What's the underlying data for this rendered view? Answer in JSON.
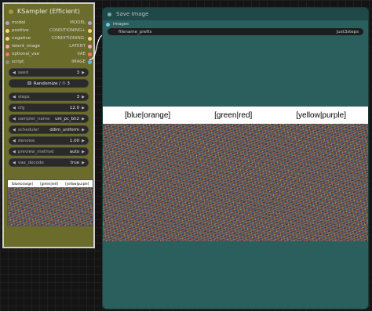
{
  "ksampler": {
    "title": "KSampler (Efficient)",
    "inputs": [
      {
        "label": "model",
        "out": "MODEL",
        "in_color": "#b39ddb",
        "out_color": "#b39ddb"
      },
      {
        "label": "positive",
        "out": "CONDITIONING+",
        "in_color": "#ffd27a",
        "out_color": "#ffd27a"
      },
      {
        "label": "negative",
        "out": "CONDITIONING-",
        "in_color": "#ffd27a",
        "out_color": "#ffd27a"
      },
      {
        "label": "latent_image",
        "out": "LATENT",
        "in_color": "#ff9cb4",
        "out_color": "#ff9cb4"
      },
      {
        "label": "optional_vae",
        "out": "VAE",
        "in_color": "#ff6e6e",
        "out_color": "#ff6e6e"
      },
      {
        "label": "script",
        "out": "IMAGE",
        "in_color": "#8a8a8a",
        "out_color": "#64b5f6"
      }
    ],
    "widgets": {
      "seed": {
        "label": "seed",
        "value": "3"
      },
      "randomize": {
        "label": "Randomize / ♲ 3"
      },
      "steps": {
        "label": "steps",
        "value": "3"
      },
      "cfg": {
        "label": "cfg",
        "value": "12.0"
      },
      "sampler_name": {
        "label": "sampler_name",
        "value": "uni_pc_bh2"
      },
      "scheduler": {
        "label": "scheduler",
        "value": "ddim_uniform"
      },
      "denoise": {
        "label": "denoise",
        "value": "1.00"
      },
      "preview_method": {
        "label": "preview_method",
        "value": "auto"
      },
      "vae_decode": {
        "label": "vae_decode",
        "value": "true"
      }
    },
    "preview_labels": [
      "[blue|orange]",
      "[green|red]",
      "[yellow|purple]"
    ]
  },
  "save_image": {
    "title": "Save Image",
    "input_label": "images",
    "prefix_label": "filename_prefix",
    "prefix_value": "just3steps",
    "labels": [
      "[blue|orange]",
      "[green|red]",
      "[yellow|purple]"
    ]
  },
  "colors": {
    "ksampler_bg": "#6b6c2b",
    "save_bg": "#2b5f5e",
    "image_wire": "#64b5f6"
  }
}
